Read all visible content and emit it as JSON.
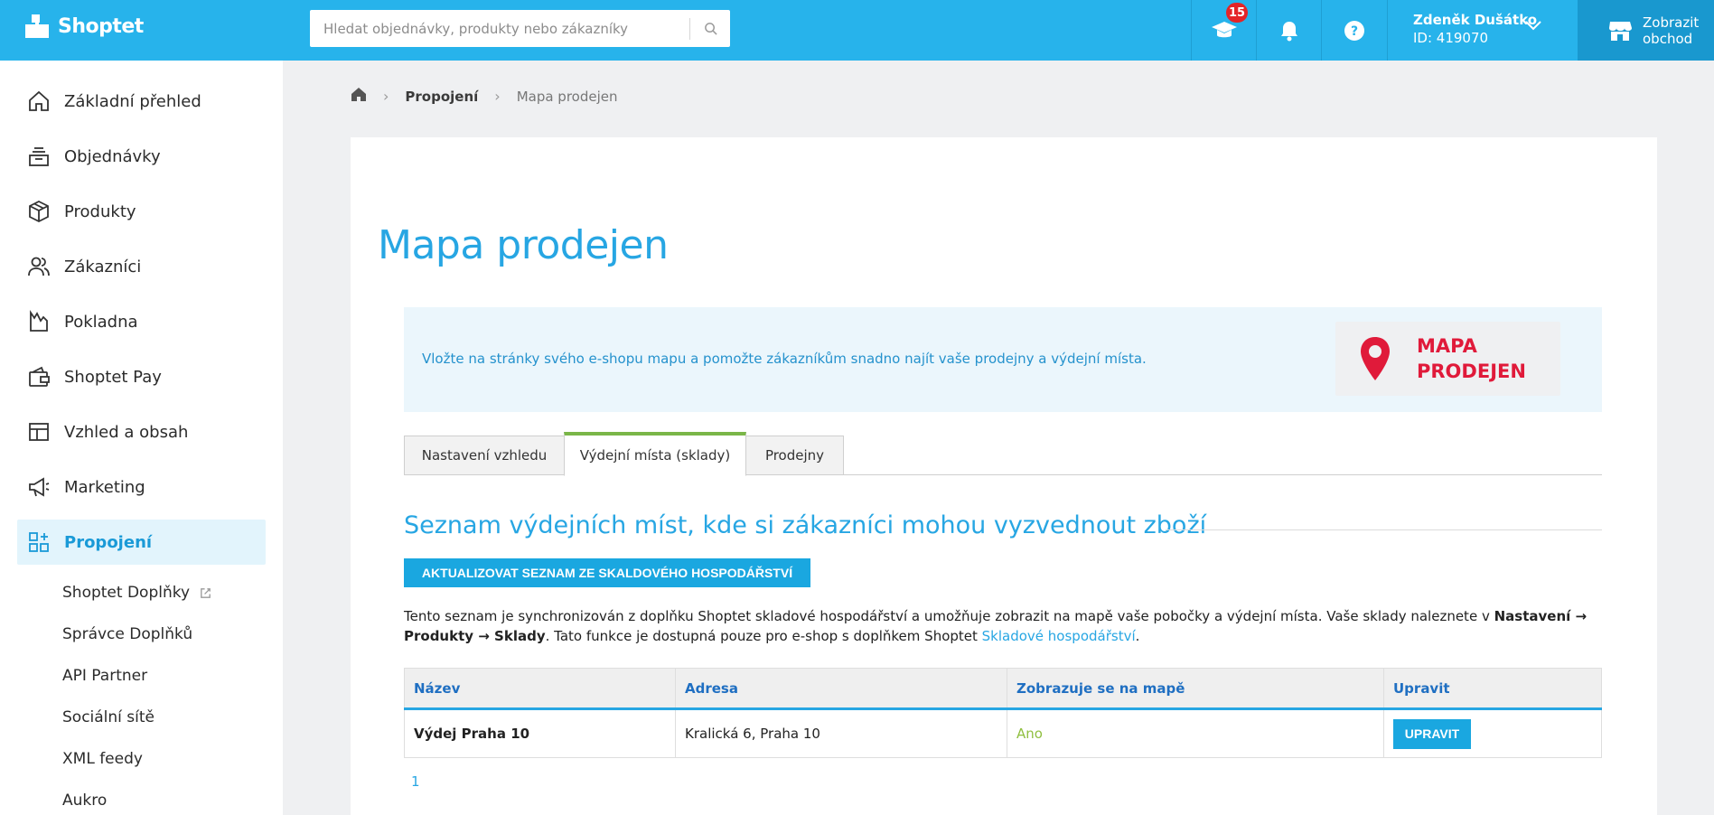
{
  "app": {
    "name": "Shoptet"
  },
  "search": {
    "placeholder": "Hledat objednávky, produkty nebo zákazníky"
  },
  "topbar": {
    "notifications_count": "15",
    "user_name": "Zdeněk Dušátko",
    "user_id": "ID: 419070",
    "show_store_label": "Zobrazit obchod"
  },
  "sidebar": {
    "items": [
      {
        "label": "Základní přehled",
        "icon": "home-icon"
      },
      {
        "label": "Objednávky",
        "icon": "orders-icon"
      },
      {
        "label": "Produkty",
        "icon": "box-icon"
      },
      {
        "label": "Zákazníci",
        "icon": "users-icon"
      },
      {
        "label": "Pokladna",
        "icon": "cash-register-icon"
      },
      {
        "label": "Shoptet Pay",
        "icon": "wallet-icon"
      },
      {
        "label": "Vzhled a obsah",
        "icon": "layout-icon"
      },
      {
        "label": "Marketing",
        "icon": "megaphone-icon"
      },
      {
        "label": "Propojení",
        "icon": "apps-icon"
      }
    ],
    "subitems": [
      {
        "label": "Shoptet Doplňky"
      },
      {
        "label": "Správce Doplňků"
      },
      {
        "label": "API Partner"
      },
      {
        "label": "Sociální sítě"
      },
      {
        "label": "XML feedy"
      },
      {
        "label": "Aukro"
      }
    ]
  },
  "breadcrumb": {
    "parent": "Propojení",
    "current": "Mapa prodejen"
  },
  "page": {
    "title": "Mapa prodejen",
    "banner_text": "Vložte na stránky svého e-shopu mapu a pomožte zákazníkům snadno najít vaše prodejny a výdejní místa.",
    "banner_logo_line1": "MAPA",
    "banner_logo_line2": "PRODEJEN",
    "tabs": [
      {
        "label": "Nastavení vzhledu"
      },
      {
        "label": "Výdejní místa (sklady)"
      },
      {
        "label": "Prodejny"
      }
    ],
    "section_title": "Seznam výdejních míst, kde si zákazníci mohou vyzvednout zboží",
    "update_button": "AKTUALIZOVAT SEZNAM ZE SKALDOVÉHO HOSPODÁŘSTVÍ",
    "desc_part1": "Tento seznam je synchronizován z doplňku Shoptet skladové hospodářství a umožňuje zobrazit na mapě vaše pobočky a výdejní místa. Vaše sklady naleznete v ",
    "desc_bold": "Nastavení → Produkty → Sklady",
    "desc_part2": ". Tato funkce je dostupná pouze pro e-shop s doplňkem Shoptet ",
    "desc_link": "Skladové hospodářství",
    "desc_end": ".",
    "table": {
      "headers": [
        "Název",
        "Adresa",
        "Zobrazuje se na mapě",
        "Upravit"
      ],
      "rows": [
        {
          "name": "Výdej Praha 10",
          "address": "Kralická 6, Praha 10",
          "shown": "Ano",
          "edit": "UPRAVIT"
        }
      ]
    },
    "pagination": "1"
  }
}
